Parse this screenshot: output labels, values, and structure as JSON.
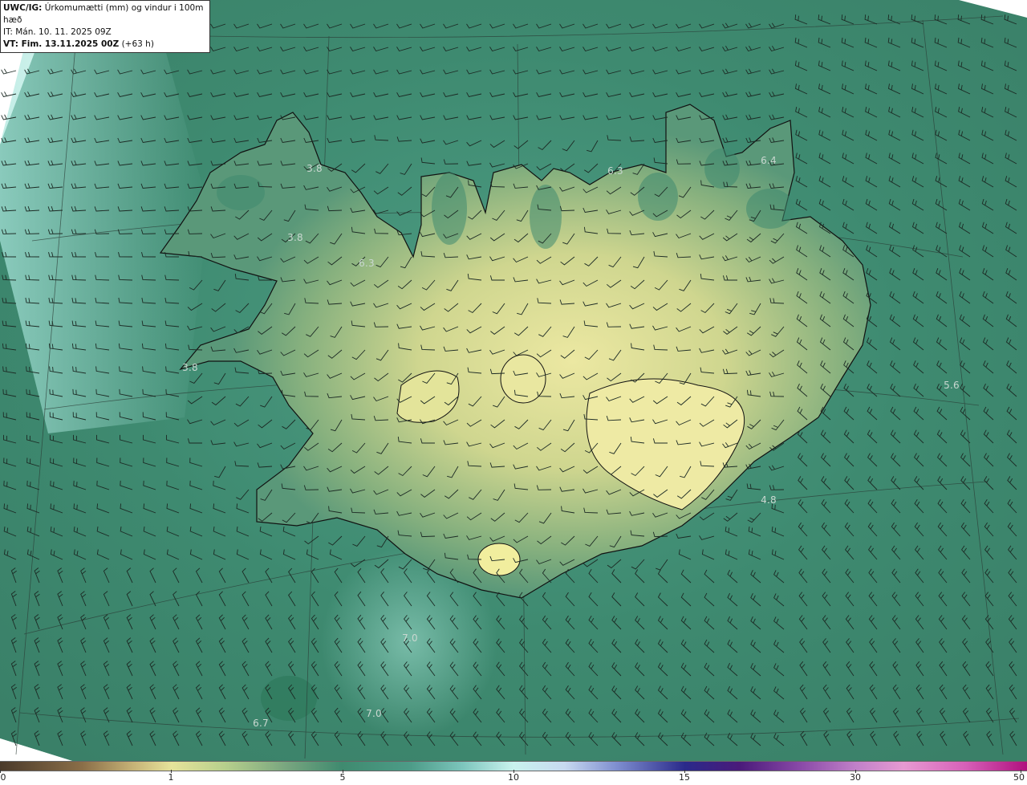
{
  "header": {
    "title_bold": "UWC/IG:",
    "title_rest": " Úrkomumætti (mm) og vindur i 100m hæð",
    "issue_time": "IT: Mán. 10. 11. 2025 09Z",
    "valid_bold": "VT: Fim. 13.11.2025 00Z",
    "valid_rest": " (+63 h)"
  },
  "map_labels": [
    {
      "text": "3.8",
      "key": "westfjords-north"
    },
    {
      "text": "3.8",
      "key": "westfjords-central"
    },
    {
      "text": "6.3",
      "key": "westfjords-east"
    },
    {
      "text": "3.8",
      "key": "snaefellsnes"
    },
    {
      "text": "6.3",
      "key": "north-coast"
    },
    {
      "text": "6.4",
      "key": "northeast"
    },
    {
      "text": "5.6",
      "key": "east-offshore"
    },
    {
      "text": "4.8",
      "key": "southeast-offshore"
    },
    {
      "text": "7.0",
      "key": "south-offshore-1"
    },
    {
      "text": "7.0",
      "key": "south-offshore-2"
    },
    {
      "text": "6.7",
      "key": "southwest-offshore"
    }
  ],
  "colorbar": {
    "ticks": [
      "0",
      "1",
      "5",
      "10",
      "15",
      "30",
      "50"
    ]
  },
  "colors": {
    "ocean": "#3f8a70",
    "land_low": "#7fa878",
    "land_high": "#e4e49a",
    "coast": "#111111",
    "barb": "#1c2a24"
  }
}
